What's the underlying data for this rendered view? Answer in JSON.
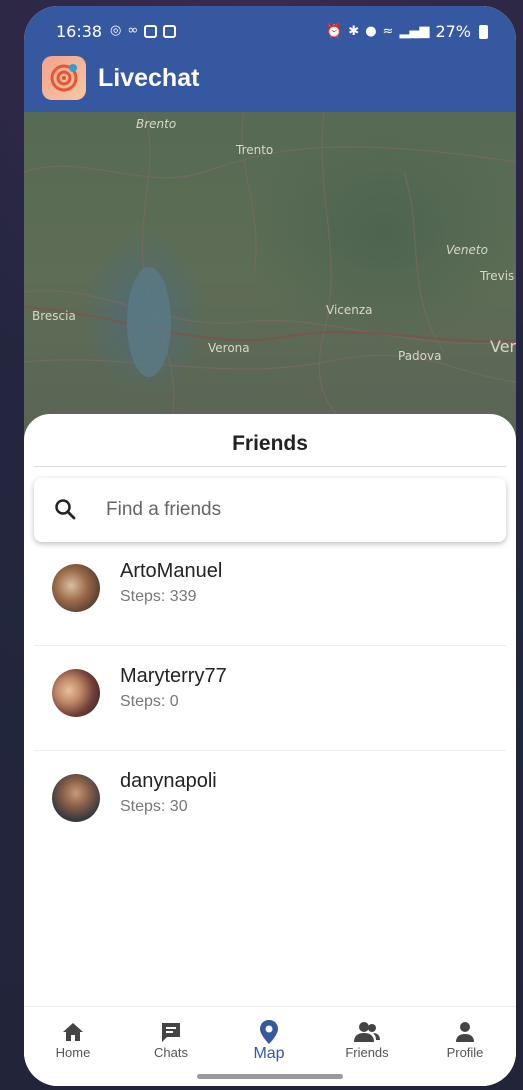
{
  "status_bar": {
    "time": "16:38",
    "battery": "27%"
  },
  "app": {
    "title": "Livechat"
  },
  "map": {
    "labels": [
      "Brento",
      "Trento",
      "Brescia",
      "Verona",
      "Vicenza",
      "Veneto",
      "Trevis",
      "Padova",
      "Ver"
    ]
  },
  "sheet": {
    "title": "Friends",
    "search_placeholder": "Find a friends"
  },
  "friends": [
    {
      "name": "ArtoManuel",
      "steps": "Steps: 339"
    },
    {
      "name": "Maryterry77",
      "steps": "Steps: 0"
    },
    {
      "name": "danynapoli",
      "steps": "Steps: 30"
    }
  ],
  "nav": [
    {
      "label": "Home",
      "icon": "home-icon"
    },
    {
      "label": "Chats",
      "icon": "chat-icon"
    },
    {
      "label": "Map",
      "icon": "map-pin-icon"
    },
    {
      "label": "Friends",
      "icon": "friends-icon"
    },
    {
      "label": "Profile",
      "icon": "profile-icon"
    }
  ],
  "colors": {
    "accent": "#3558a0"
  }
}
